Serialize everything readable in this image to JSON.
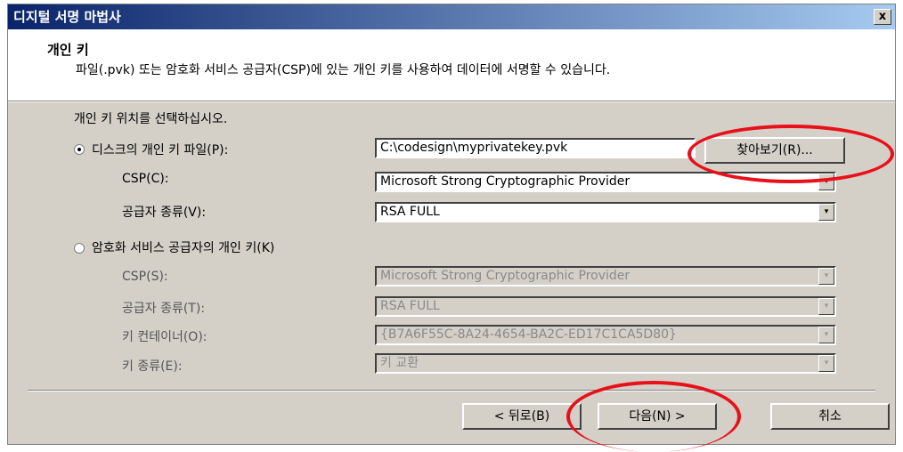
{
  "window": {
    "title": "디지털 서명 마법사",
    "close": "x",
    "titlebar_gradient": [
      "#0a246a",
      "#a6caf0"
    ]
  },
  "header": {
    "title": "개인 키",
    "description": "파일(.pvk) 또는 암호화 서비스 공급자(CSP)에 있는 개인 키를 사용하여 데이터에 서명할 수 있습니다."
  },
  "body": {
    "instruction": "개인 키 위치를 선택하십시오.",
    "option_file": {
      "label": "디스크의 개인 키 파일(P):",
      "selected": true,
      "path_value": "C:\\codesign\\myprivatekey.pvk",
      "browse_label": "찾아보기(R)...",
      "csp_label": "CSP(C):",
      "csp_value": "Microsoft Strong Cryptographic Provider",
      "provider_type_label": "공급자 종류(V):",
      "provider_type_value": "RSA FULL"
    },
    "option_csp": {
      "label": "암호화 서비스 공급자의 개인 키(K)",
      "selected": false,
      "csp_label": "CSP(S):",
      "csp_value": "Microsoft Strong Cryptographic Provider",
      "provider_type_label": "공급자 종류(T):",
      "provider_type_value": "RSA FULL",
      "container_label": "키 컨테이너(O):",
      "container_value": "{B7A6F55C-8A24-4654-BA2C-ED17C1CA5D80}",
      "key_type_label": "키 종류(E):",
      "key_type_value": "키 교환"
    }
  },
  "footer": {
    "back_label": "< 뒤로(B)",
    "next_label": "다음(N) >",
    "cancel_label": "취소"
  },
  "icons": {
    "dropdown": "▾",
    "close": "close-icon"
  },
  "colors": {
    "dialog_face": "#d4d0c8",
    "highlight_circle": "#e8101a"
  }
}
